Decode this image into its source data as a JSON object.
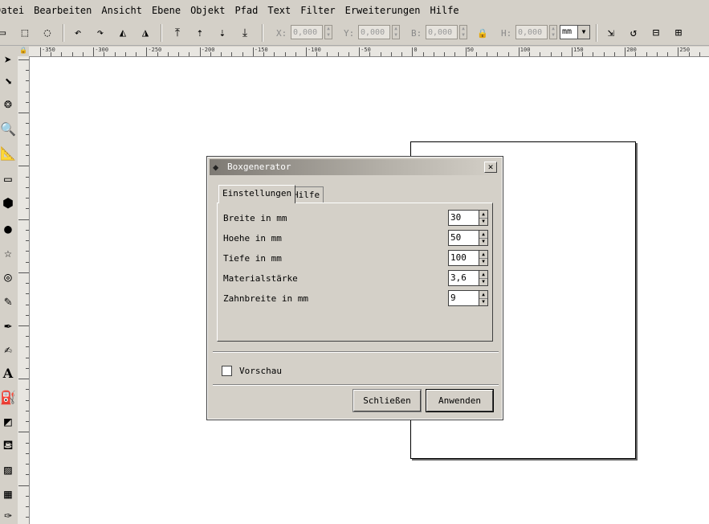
{
  "menu": [
    "Datei",
    "Bearbeiten",
    "Ansicht",
    "Ebene",
    "Objekt",
    "Pfad",
    "Text",
    "Filter",
    "Erweiterungen",
    "Hilfe"
  ],
  "toolbar": {
    "x_label": "X:",
    "x_value": "0,000",
    "y_label": "Y:",
    "y_value": "0,000",
    "w_label": "B:",
    "w_value": "0,000",
    "h_label": "H:",
    "h_value": "0,000",
    "unit": "mm"
  },
  "ruler": {
    "labels": [
      "-350",
      "-300",
      "-250",
      "-200",
      "-150",
      "-100",
      "-50",
      "0",
      "50",
      "100",
      "150",
      "200",
      "250"
    ]
  },
  "dialog": {
    "title": "Boxgenerator",
    "close_symbol": "✕",
    "tabs": [
      "Einstellungen",
      "Hilfe"
    ],
    "fields": [
      {
        "label": "Breite in mm",
        "value": "30"
      },
      {
        "label": "Hoehe in mm",
        "value": "50"
      },
      {
        "label": "Tiefe in mm",
        "value": "100"
      },
      {
        "label": "Materialstärke",
        "value": "3,6"
      },
      {
        "label": "Zahnbreite in mm",
        "value": "9"
      }
    ],
    "preview_label": "Vorschau",
    "close_button": "Schließen",
    "apply_button": "Anwenden"
  }
}
